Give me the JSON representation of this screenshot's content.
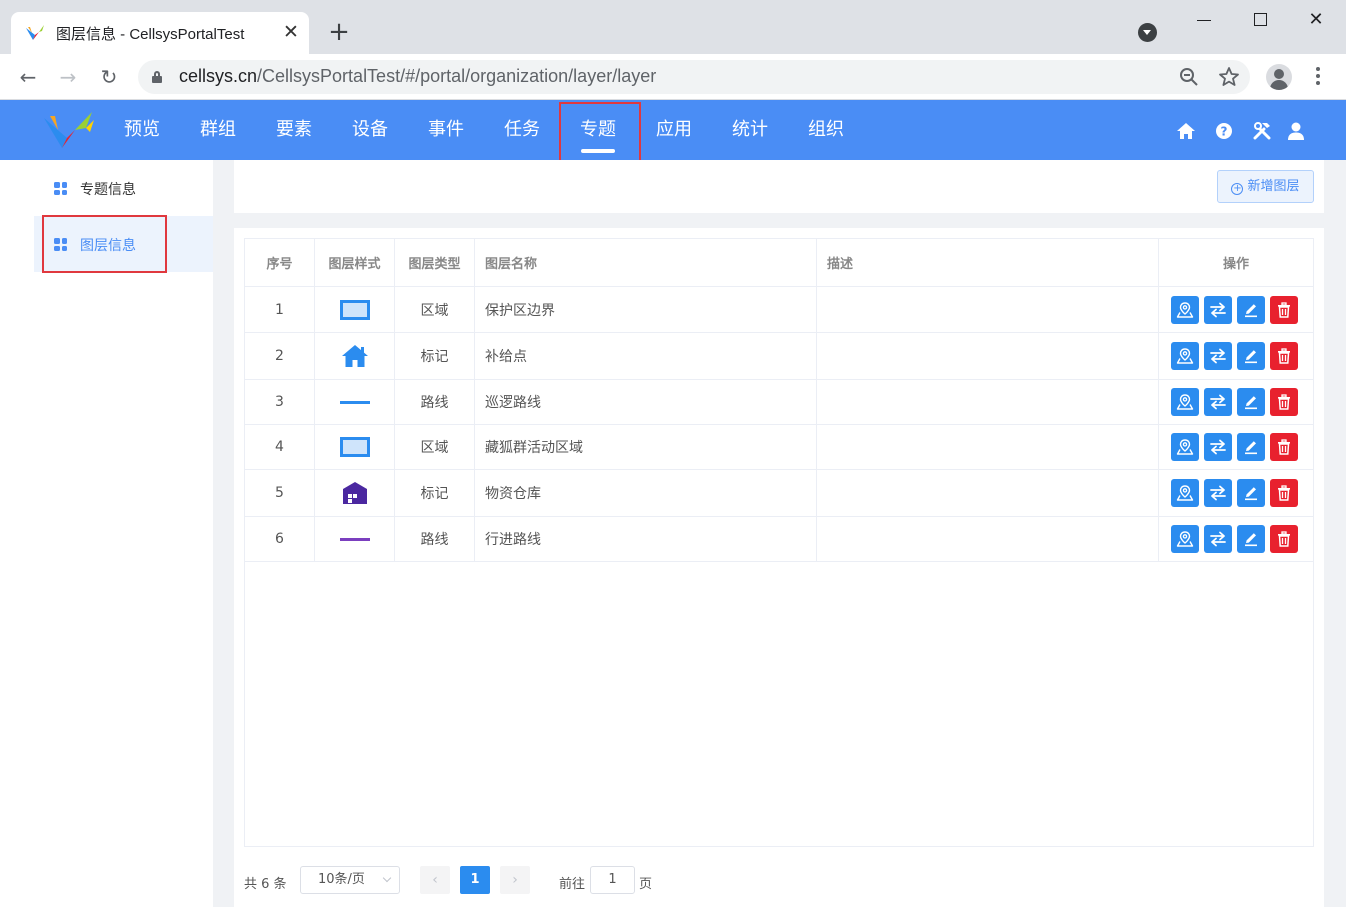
{
  "browser": {
    "tab_title": "图层信息 - CellsysPortalTest",
    "url_host": "cellsys.cn",
    "url_path": "/CellsysPortalTest/#/portal/organization/layer/layer"
  },
  "header": {
    "nav": [
      {
        "label": "预览"
      },
      {
        "label": "群组"
      },
      {
        "label": "要素"
      },
      {
        "label": "设备"
      },
      {
        "label": "事件"
      },
      {
        "label": "任务"
      },
      {
        "label": "专题",
        "active": true
      },
      {
        "label": "应用"
      },
      {
        "label": "统计"
      },
      {
        "label": "组织"
      }
    ],
    "icons": [
      "home-icon",
      "help-icon",
      "tools-icon",
      "user-icon"
    ]
  },
  "sidebar": {
    "items": [
      {
        "label": "专题信息",
        "active": false
      },
      {
        "label": "图层信息",
        "active": true
      }
    ]
  },
  "toolbar": {
    "add_label": "新增图层"
  },
  "table": {
    "columns": [
      "序号",
      "图层样式",
      "图层类型",
      "图层名称",
      "描述",
      "操作"
    ],
    "rows": [
      {
        "index": "1",
        "style": "area-rect",
        "type": "区域",
        "name": "保护区边界",
        "desc": ""
      },
      {
        "index": "2",
        "style": "house-blue",
        "type": "标记",
        "name": "补给点",
        "desc": ""
      },
      {
        "index": "3",
        "style": "line-blue",
        "type": "路线",
        "name": "巡逻路线",
        "desc": ""
      },
      {
        "index": "4",
        "style": "area-rect",
        "type": "区域",
        "name": "藏狐群活动区域",
        "desc": ""
      },
      {
        "index": "5",
        "style": "warehouse-purple",
        "type": "标记",
        "name": "物资仓库",
        "desc": ""
      },
      {
        "index": "6",
        "style": "line-purple",
        "type": "路线",
        "name": "行进路线",
        "desc": ""
      }
    ],
    "actions": [
      "map-marker-icon",
      "swap-icon",
      "edit-icon",
      "delete-icon"
    ]
  },
  "pagination": {
    "total": "共 6 条",
    "page_size": "10条/页",
    "current": "1",
    "goto_label": "前往",
    "goto_value": "1",
    "goto_unit": "页"
  },
  "colors": {
    "primary": "#4a8df5",
    "action_blue": "#2b8cef",
    "danger": "#e8212e",
    "highlight": "#e0383e",
    "purple": "#4b28a0",
    "purple_line": "#7b3fbf"
  }
}
